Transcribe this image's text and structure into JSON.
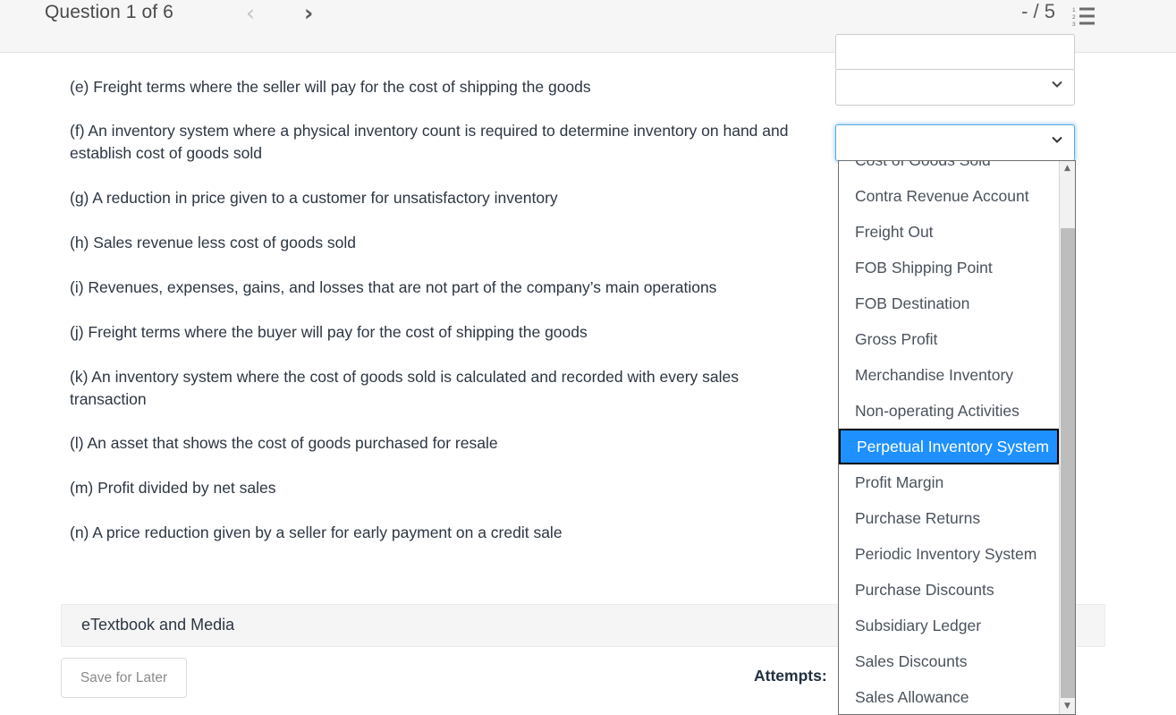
{
  "header": {
    "question_counter": "Question 1 of 6",
    "prev_label": "‹",
    "next_label": "›",
    "score": "- / 5",
    "list_icon_name": "numbered-list-icon"
  },
  "question": {
    "items": [
      {
        "key": "e",
        "text": "(e) Freight terms where the seller will pay for the cost of shipping the goods"
      },
      {
        "key": "f",
        "text": "(f) An inventory system where a physical inventory count is required to determine inventory on hand and establish cost of goods sold"
      },
      {
        "key": "g",
        "text": "(g) A reduction in price given to a customer for unsatisfactory inventory"
      },
      {
        "key": "h",
        "text": "(h) Sales revenue less cost of goods sold"
      },
      {
        "key": "i",
        "text": "(i) Revenues, expenses, gains, and losses that are not part of the company’s main operations"
      },
      {
        "key": "j",
        "text": "(j) Freight terms where the buyer will pay for the cost of shipping the goods"
      },
      {
        "key": "k",
        "text": "(k) An inventory system where the cost of goods sold is calculated and recorded with every sales transaction"
      },
      {
        "key": "l",
        "text": "(l) An asset that shows the cost of goods purchased for resale"
      },
      {
        "key": "m",
        "text": "(m) Profit divided by net sales"
      },
      {
        "key": "n",
        "text": "(n) A price reduction given by a seller for early payment on a credit sale"
      }
    ]
  },
  "selects": {
    "values": [
      "",
      "",
      ""
    ],
    "caret_icon_name": "chevron-down-icon"
  },
  "dropdown": {
    "open": true,
    "selected": "Perpetual Inventory System",
    "highlight_color": "#1e90ff",
    "options": [
      "Cost of Goods Sold",
      "Contra Revenue Account",
      "Freight Out",
      "FOB Shipping Point",
      "FOB Destination",
      "Gross Profit",
      "Merchandise Inventory",
      "Non-operating Activities",
      "Perpetual Inventory System",
      "Profit Margin",
      "Purchase Returns",
      "Periodic Inventory System",
      "Purchase Discounts",
      "Subsidiary Ledger",
      "Sales Discounts",
      "Sales Allowance"
    ],
    "scroll_up_label": "▲",
    "scroll_down_label": "▼"
  },
  "footer": {
    "etextbook_label": "eTextbook and Media",
    "save_for_later_label": "Save for Later",
    "attempts_label": "Attempts:"
  }
}
